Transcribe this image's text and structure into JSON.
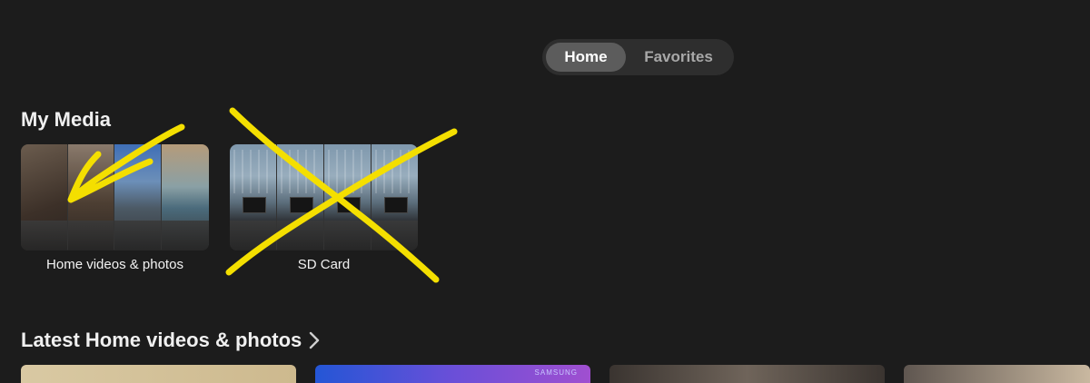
{
  "tabs": [
    {
      "label": "Home",
      "selected": true
    },
    {
      "label": "Favorites",
      "selected": false
    }
  ],
  "sections": {
    "my_media": {
      "title": "My Media",
      "items": [
        {
          "label": "Home videos & photos"
        },
        {
          "label": "SD Card"
        }
      ]
    },
    "latest": {
      "title": "Latest Home videos & photos",
      "thumbnails": [
        {
          "badge": ""
        },
        {
          "badge": "SAMSUNG"
        },
        {
          "badge": ""
        },
        {
          "badge": ""
        }
      ]
    }
  },
  "annotations": {
    "check_color": "#f4df00",
    "cross_color": "#f4df00"
  },
  "colors": {
    "background": "#1c1c1c",
    "tab_track": "#2e2e2e",
    "tab_selected": "#5c5c5c"
  }
}
